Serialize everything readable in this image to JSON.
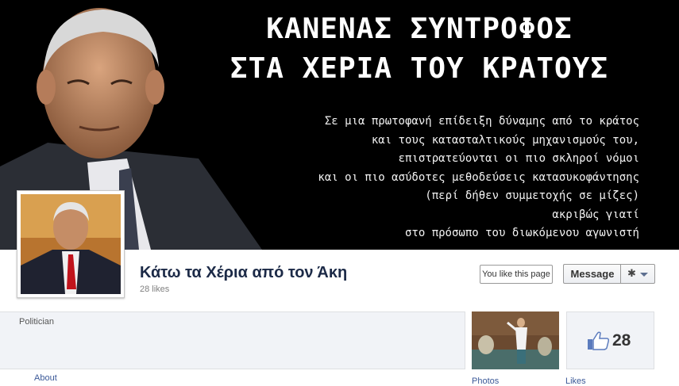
{
  "cover": {
    "headline_line1": "ΚΑΝΕΝΑΣ ΣΥΝΤΡΟΦΟΣ",
    "headline_line2": "ΣΤΑ ΧΕΡΙΑ ΤΟΥ ΚΡΑΤΟΥΣ",
    "text_lines": [
      "Σε μια πρωτοφανή επίδειξη δύναμης από το κράτος",
      "και τους κατασταλτικούς μηχανισμούς του,",
      "επιστρατεύονται οι πιο σκληροί νόμοι",
      "και οι πιο ασύδοτες μεθοδεύσεις κατασυκοφάντησης",
      "(περί δήθεν συμμετοχής σε μίζες)",
      "ακριβώς γιατί",
      "στο πρόσωπο του διωκόμενου αγωνιστή"
    ]
  },
  "page": {
    "title": "Κάτω τα Χέρια από τον Άκη",
    "likes_text": "28 likes",
    "category": "Politician"
  },
  "buttons": {
    "like_label": "You like this page",
    "message_label": "Message",
    "settings_icon": "gear-icon"
  },
  "tabs": {
    "about": "About",
    "photos": "Photos",
    "likes": "Likes",
    "likes_count": "28"
  },
  "colors": {
    "link": "#3b5998",
    "title": "#1c2a47",
    "cover_bg": "#000000"
  }
}
